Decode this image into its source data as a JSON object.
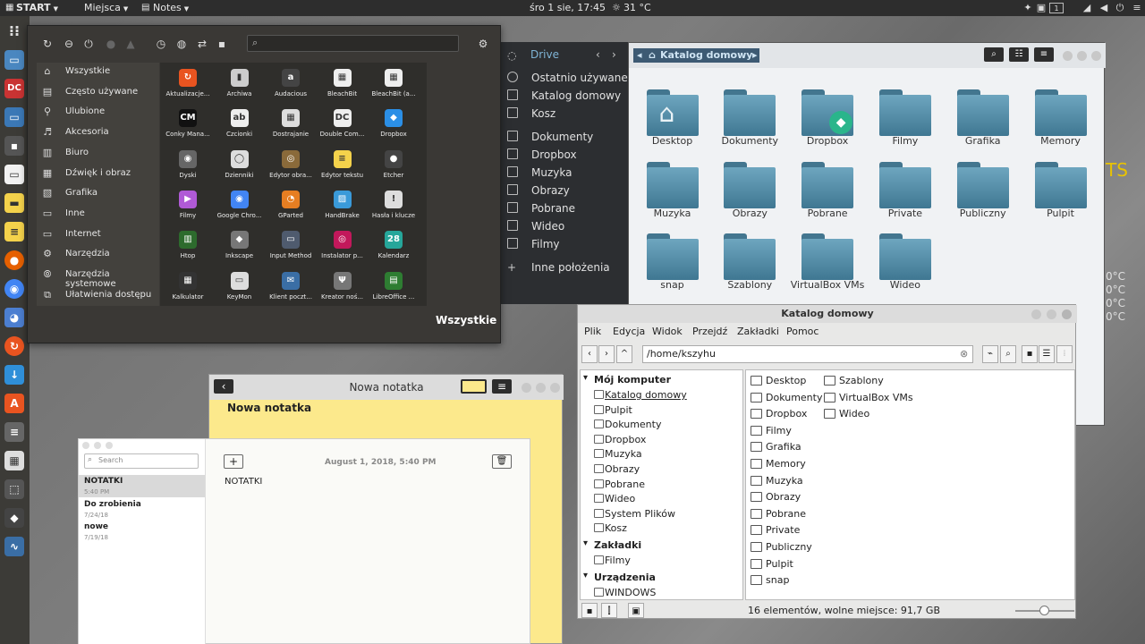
{
  "topbar": {
    "start": "START",
    "places": "Miejsca",
    "notes": "Notes",
    "clock": "śro 1 sie, 17:45",
    "temp": "31 °C",
    "workspace": "1"
  },
  "desktop": {
    "yellow_text": "TS",
    "temps": [
      "0°C",
      "0°C",
      "0°C",
      "0°C"
    ]
  },
  "menu": {
    "search_placeholder": "",
    "categories": [
      "Wszystkie",
      "Często używane",
      "Ulubione",
      "Akcesoria",
      "Biuro",
      "Dźwięk i obraz",
      "Grafika",
      "Inne",
      "Internet",
      "Narzędzia",
      "Narzędzia systemowe",
      "Ułatwienia dostępu"
    ],
    "apps": [
      "Aktualizacje...",
      "Archiwa",
      "Audacious",
      "BleachBit",
      "BleachBit (a...",
      "Conky Mana...",
      "Czcionki",
      "Dostrajanie",
      "Double Com...",
      "Dropbox",
      "Dyski",
      "Dzienniki",
      "Edytor obra...",
      "Edytor tekstu",
      "Etcher",
      "Filmy",
      "Google Chro...",
      "GParted",
      "HandBrake",
      "Hasła i klucze",
      "Htop",
      "Inkscape",
      "Input Method",
      "Instalator p...",
      "Kalendarz",
      "Kalkulator",
      "KeyMon",
      "Klient poczt...",
      "Kreator noś...",
      "LibreOffice ..."
    ],
    "footer": "Wszystkie"
  },
  "nautilus": {
    "drive_label": "Drive",
    "breadcrumb": "Katalog domowy",
    "sidebar": [
      "Ostatnio używane",
      "Katalog domowy",
      "Kosz",
      "Dokumenty",
      "Dropbox",
      "Muzyka",
      "Obrazy",
      "Pobrane",
      "Wideo",
      "Filmy",
      "Inne położenia"
    ],
    "folders": [
      "Desktop",
      "Dokumenty",
      "Dropbox",
      "Filmy",
      "Grafika",
      "Memory",
      "Muzyka",
      "Obrazy",
      "Pobrane",
      "Private",
      "Publiczny",
      "Pulpit",
      "snap",
      "Szablony",
      "VirtualBox VMs",
      "Wideo"
    ]
  },
  "caja": {
    "title": "Katalog domowy",
    "menu": [
      "Plik",
      "Edycja",
      "Widok",
      "Przejdź",
      "Zakładki",
      "Pomoc"
    ],
    "path": "/home/kszyhu",
    "side_sections": {
      "computer": "Mój komputer",
      "bookmarks": "Zakładki",
      "devices": "Urządzenia"
    },
    "computer_items": [
      "Katalog domowy",
      "Pulpit",
      "Dokumenty",
      "Dropbox",
      "Muzyka",
      "Obrazy",
      "Pobrane",
      "Wideo",
      "System Plików",
      "Kosz"
    ],
    "bookmark_items": [
      "Filmy"
    ],
    "device_items": [
      "WINDOWS"
    ],
    "files_col1": [
      "Desktop",
      "Dokumenty",
      "Dropbox",
      "Filmy",
      "Grafika",
      "Memory",
      "Muzyka",
      "Obrazy",
      "Pobrane",
      "Private",
      "Publiczny",
      "Pulpit",
      "snap"
    ],
    "files_col2": [
      "Szablony",
      "VirtualBox VMs",
      "Wideo"
    ],
    "status": "16 elementów, wolne miejsce: 91,7 GB"
  },
  "sticky": {
    "title": "Nowa notatka",
    "body": "Nowa notatka"
  },
  "notes": {
    "search_placeholder": "Search",
    "items": [
      {
        "title": "NOTATKI",
        "date": "5:40 PM"
      },
      {
        "title": "Do zrobienia",
        "date": "7/24/18"
      },
      {
        "title": "nowe",
        "date": "7/19/18"
      }
    ],
    "current_date": "August 1, 2018, 5:40 PM",
    "current_text": "NOTATKI"
  }
}
